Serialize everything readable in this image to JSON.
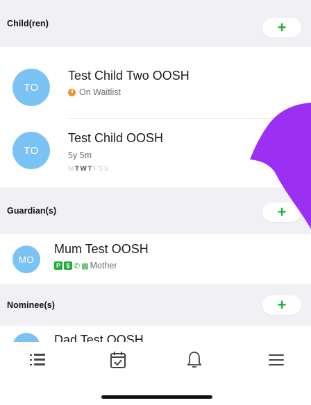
{
  "children_section": {
    "title": "Child(ren)",
    "add_label": "+"
  },
  "children": [
    {
      "initials": "TO",
      "name": "Test Child Two OOSH",
      "status": "On Waitlist"
    },
    {
      "initials": "TO",
      "name": "Test Child OOSH",
      "age": "5y 5m",
      "days": [
        {
          "letter": "M",
          "active": false
        },
        {
          "letter": "T",
          "active": true
        },
        {
          "letter": "W",
          "active": true
        },
        {
          "letter": "T",
          "active": true
        },
        {
          "letter": "F",
          "active": false
        },
        {
          "letter": "S",
          "active": false
        },
        {
          "letter": "S",
          "active": false
        }
      ]
    }
  ],
  "guardians_section": {
    "title": "Guardian(s)",
    "add_label": "+"
  },
  "guardians": [
    {
      "initials": "MO",
      "name": "Mum Test OOSH",
      "badges": [
        "P",
        "$"
      ],
      "relation": "Mother"
    }
  ],
  "nominees_section": {
    "title": "Nominee(s)",
    "add_label": "+"
  },
  "nominees": [
    {
      "name": "Dad Test OOSH"
    }
  ],
  "tabbar": {
    "items": [
      {
        "icon": "list-icon"
      },
      {
        "icon": "calendar-check-icon"
      },
      {
        "icon": "bell-icon"
      },
      {
        "icon": "menu-icon"
      }
    ]
  },
  "colors": {
    "accent_green": "#1fae3a",
    "avatar_blue": "#7cc3f5",
    "waitlist_orange": "#f0922c",
    "overlay_purple": "#9b30f2",
    "section_bg": "#f1f0f5"
  }
}
